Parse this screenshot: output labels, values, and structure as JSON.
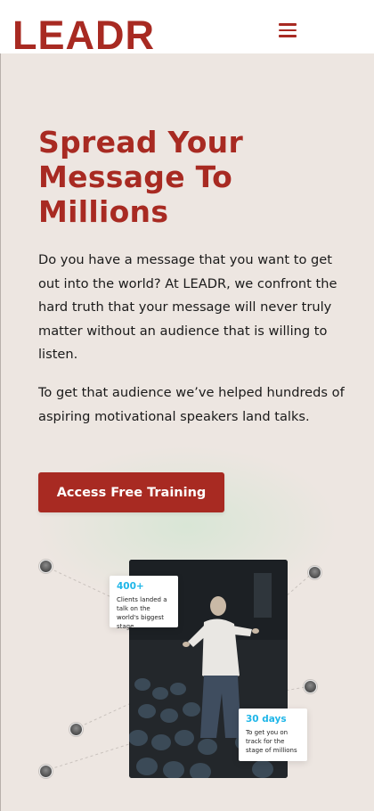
{
  "header": {
    "logo": "LEADR",
    "menu_icon": "hamburger-icon"
  },
  "hero": {
    "title": "Spread Your\nMessage To\nMillions",
    "paragraph1": "Do you have a message that you want to get out into the world? At LEADR, we confront the hard truth that your message will never truly matter without an audience that is willing to listen.",
    "paragraph2": "To get that audience we’ve helped hundreds of aspiring motivational speakers land talks.",
    "cta_label": "Access Free Training"
  },
  "stats": [
    {
      "value": "400+",
      "description": "Clients landed a talk on the world's biggest stage"
    },
    {
      "value": "30 days",
      "description": "To get you on track for the stage of millions"
    }
  ],
  "colors": {
    "brand": "#a82a22",
    "accent": "#1fb6e8",
    "background": "#ede6e1"
  }
}
